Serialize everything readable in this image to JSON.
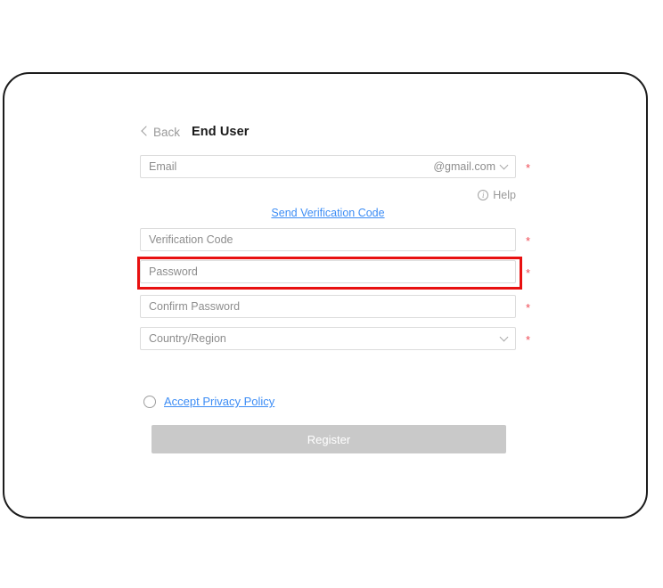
{
  "frame": {
    "border_color": "#1c1c1c"
  },
  "header": {
    "back_label": "Back",
    "back_icon": "chevron-left-icon",
    "title": "End User"
  },
  "form": {
    "fields": [
      {
        "name": "email",
        "placeholder": "Email",
        "suffix": "@gmail.com",
        "has_dropdown": true,
        "required": true,
        "required_marker": "*"
      },
      {
        "name": "verification-code",
        "placeholder": "Verification Code",
        "suffix": "",
        "has_dropdown": false,
        "required": true,
        "required_marker": "*"
      },
      {
        "name": "password",
        "placeholder": "Password",
        "suffix": "",
        "has_dropdown": false,
        "required": true,
        "required_marker": "*",
        "highlighted": true
      },
      {
        "name": "confirm-password",
        "placeholder": "Confirm Password",
        "suffix": "",
        "has_dropdown": false,
        "required": true,
        "required_marker": "*"
      },
      {
        "name": "country-region",
        "placeholder": "Country/Region",
        "suffix": "",
        "has_dropdown": true,
        "required": true,
        "required_marker": "*"
      }
    ],
    "help": {
      "icon": "info-circle-icon",
      "label": "Help"
    },
    "send_verification_code_link": "Send Verification Code",
    "privacy": {
      "link_label": "Accept Privacy Policy",
      "checked": false
    },
    "register_button_label": "Register"
  },
  "colors": {
    "link": "#3d8df5",
    "required_star": "#ef4b55",
    "highlight_box": "#e81010",
    "button_disabled_bg": "#c9c9c9",
    "placeholder_text": "#8d8d8d",
    "input_border": "#dcdcdc"
  },
  "annotation": {
    "type": "red-rectangle-highlight",
    "target": "password-input"
  }
}
